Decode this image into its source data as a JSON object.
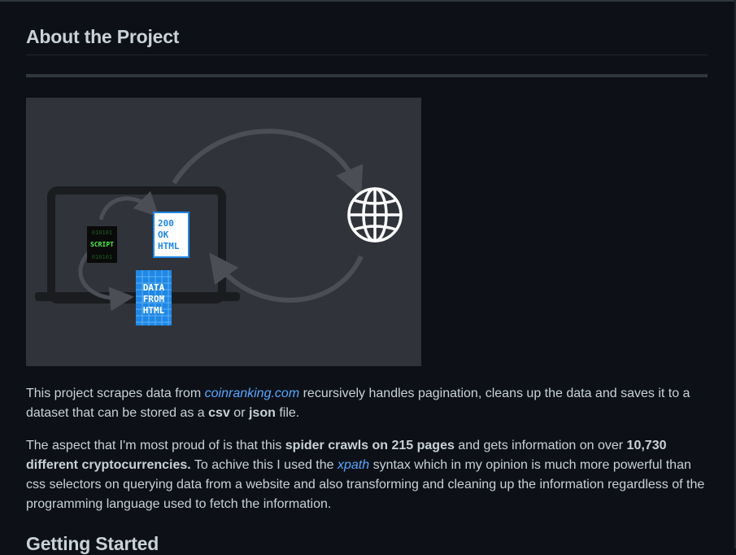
{
  "about": {
    "heading": "About the Project"
  },
  "illustration": {
    "script_label": "SCRIPT",
    "binary_top": "010101",
    "binary_mid": "010101",
    "binary_bottom": "010101",
    "response_line1": "200",
    "response_line2": "OK",
    "response_line3": "HTML",
    "data_line1": "DATA",
    "data_line2": "FROM",
    "data_line3": "HTML"
  },
  "paragraph1": {
    "text1": "This project scrapes data from ",
    "link": "coinranking.com",
    "text2": " recursively handles pagination, cleans up the data and saves it to a dataset that can be stored as a ",
    "bold1": "csv",
    "text3": " or ",
    "bold2": "json",
    "text4": " file."
  },
  "paragraph2": {
    "text1": "The aspect that I'm most proud of is that this ",
    "bold1": "spider crawls on 215 pages",
    "text2": " and gets information on over ",
    "bold2": "10,730 different cryptocurrencies.",
    "text3": " To achive this I used the ",
    "link": "xpath",
    "text4": " syntax which in my opinion is much more powerful than css selectors on querying data from a website and also transforming and cleaning up the information regardless of the programming language used to fetch the information."
  },
  "getting_started": {
    "heading": "Getting Started"
  },
  "colors": {
    "background": "#0d1117",
    "text": "#c9d1d9",
    "link": "#58a6ff",
    "illustration_bg": "#30343a",
    "data_blue": "#1f87e5"
  }
}
